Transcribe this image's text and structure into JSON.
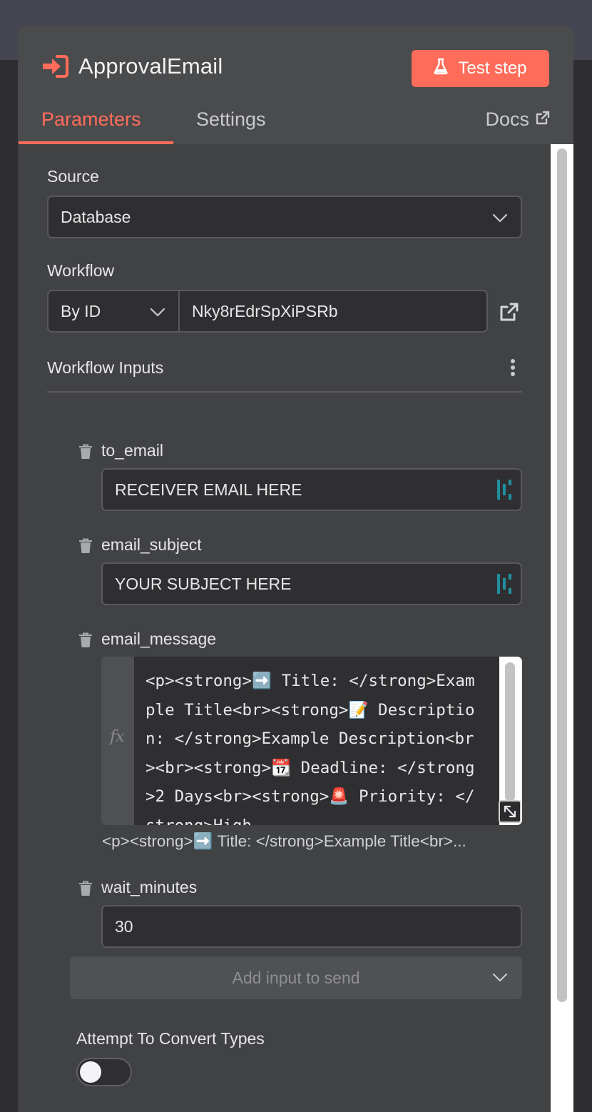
{
  "node": {
    "title": "ApprovalEmail",
    "test_step_label": "Test step"
  },
  "tabs": [
    {
      "label": "Parameters",
      "active": true
    },
    {
      "label": "Settings",
      "active": false
    }
  ],
  "docs_label": "Docs",
  "source": {
    "label": "Source",
    "value": "Database"
  },
  "workflow": {
    "label": "Workflow",
    "mode": "By ID",
    "id_value": "Nky8rEdrSpXiPSRb"
  },
  "workflow_inputs": {
    "title": "Workflow Inputs",
    "fields": [
      {
        "name": "to_email",
        "value": "RECEIVER EMAIL HERE"
      },
      {
        "name": "email_subject",
        "value": "YOUR SUBJECT HERE"
      },
      {
        "name": "email_message",
        "code_lines": [
          "<p><strong>➡️ Title: </strong>Exam",
          "ple Title<br><strong>📝 Descriptio",
          "n: </strong>Example Description<br",
          "><br><strong>📆 Deadline: </strong",
          ">2 Days<br><strong>🚨 Priority: </",
          "strong>High"
        ],
        "preview": "<p><strong>➡️ Title: </strong>Example Title<br>..."
      },
      {
        "name": "wait_minutes",
        "value": "30"
      }
    ],
    "add_input_label": "Add input to send"
  },
  "convert_types": {
    "label": "Attempt To Convert Types",
    "enabled": false
  },
  "colors": {
    "accent": "#ff6d5a",
    "panel": "#414244",
    "input_bg": "#2f2f31",
    "mapping_icon": "#1f8f9f"
  },
  "icons": {
    "node": "sign-in-arrow-icon",
    "test": "flask-icon",
    "docs": "external-link-icon",
    "workflow_open": "external-link-icon",
    "options": "vertical-dots-icon",
    "delete": "trash-icon",
    "mapping": "mapping-bars-icon",
    "resize": "resize-arrow-icon"
  }
}
